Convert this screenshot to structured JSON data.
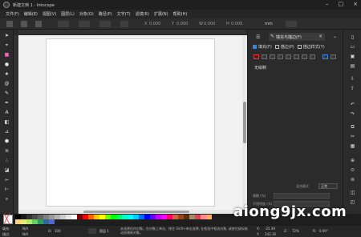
{
  "window": {
    "title": "新建文档 1 - Inkscape"
  },
  "menu": [
    "文件(F)",
    "编辑(E)",
    "视图(V)",
    "图层(L)",
    "对象(O)",
    "路径(P)",
    "文字(T)",
    "滤镜(R)",
    "扩展(N)",
    "帮助(H)"
  ],
  "toolbar": {
    "x_label": "X",
    "x_value": "0.000",
    "y_label": "Y",
    "y_value": "0.000",
    "w_label": "W",
    "w_value": "0.000",
    "h_label": "H",
    "h_value": "0.000",
    "unit": "mm"
  },
  "panel": {
    "tab_label": "填充与描边(F)",
    "subtabs": [
      "填充(F)",
      "描边(P)",
      "描边样式(Y)"
    ],
    "no_paint": "无绘制",
    "blur_label": "模糊 (%)",
    "opacity_label": "不透明度 (%)",
    "blend_label": "混合模式",
    "blend_value": "正常"
  },
  "statusbar": {
    "fill_label": "填充:",
    "fill_value": "N/A",
    "stroke_label": "描边:",
    "stroke_value": "N/A",
    "opacity_label": "O:",
    "opacity_value": "100",
    "layer_label": "图层 1",
    "message": "未选择任何对象。在对象上单击、按住 Shift+单击选择, 在框选中框选对象, 或按住鼠标拖动创建新对象。",
    "x_label": "X:",
    "x_value": "-25.39",
    "y_label": "Y:",
    "y_value": "242.16",
    "zoom_label": "Z:",
    "zoom_value": "72%",
    "rotate_label": "R:",
    "rotate_value": "0.00°"
  },
  "palette_colors": [
    "#000000",
    "#1a1a1a",
    "#333333",
    "#4d4d4d",
    "#666666",
    "#808080",
    "#999999",
    "#b3b3b3",
    "#cccccc",
    "#e6e6e6",
    "#ffffff",
    "#800000",
    "#ff0000",
    "#ff6600",
    "#ffcc00",
    "#ffff00",
    "#66ff00",
    "#00ff00",
    "#00ff66",
    "#00ffcc",
    "#00ffff",
    "#00ccff",
    "#0066ff",
    "#0000ff",
    "#6600ff",
    "#cc00ff",
    "#ff00ff",
    "#ff0066",
    "#cc6633",
    "#994422",
    "#553311",
    "#aa8866",
    "#dd4455",
    "#ff8888",
    "#ffaa66",
    "#ffd27a",
    "#e8e87a",
    "#aaee66",
    "#66cc66",
    "#339966",
    "#336699",
    "#5566cc"
  ],
  "watermark": "aiong9jx.com"
}
